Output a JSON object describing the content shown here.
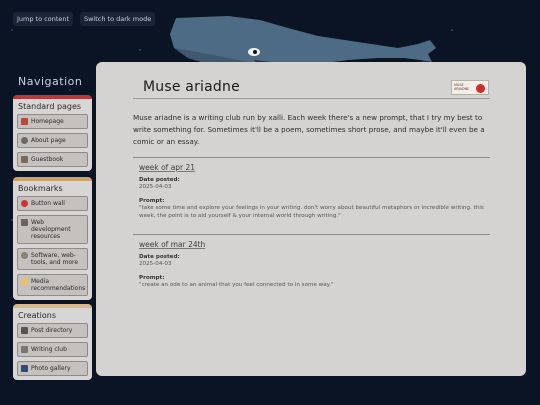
{
  "topbar": {
    "skip_label": "Jump to content",
    "dark_label": "Switch to dark mode"
  },
  "sidebar": {
    "title": "Navigation",
    "sections": [
      {
        "heading": "Standard pages",
        "items": [
          {
            "label": "Homepage",
            "icon": "home-icon"
          },
          {
            "label": "About page",
            "icon": "info-icon"
          },
          {
            "label": "Guestbook",
            "icon": "book-icon"
          }
        ]
      },
      {
        "heading": "Bookmarks",
        "items": [
          {
            "label": "Button wall",
            "icon": "heart-icon"
          },
          {
            "label": "Web development resources",
            "icon": "tools-icon"
          },
          {
            "label": "Software, web-tools, and more",
            "icon": "gear-icon"
          },
          {
            "label": "Media recommendations",
            "icon": "folder-icon"
          }
        ]
      },
      {
        "heading": "Creations",
        "items": [
          {
            "label": "Post directory",
            "icon": "list-icon"
          },
          {
            "label": "Writing club",
            "icon": "pencil-icon"
          },
          {
            "label": "Photo gallery",
            "icon": "camera-icon"
          }
        ]
      }
    ]
  },
  "main": {
    "title": "Muse ariadne",
    "badge_text": "MUSE ARIADNE",
    "intro": "Muse ariadne is a writing club run by xalli. Each week there's a new prompt, that I try my best to write something for. Sometimes it'll be a poem, sometimes short prose, and maybe it'll even be a comic or an essay.",
    "posts": [
      {
        "title": "week of apr 21",
        "date_label": "Date posted:",
        "date": "2025-04-03",
        "prompt_label": "Prompt:",
        "prompt": "\"take some time and explore your feelings in your writing. don't worry about beautiful metaphors or incredible writing. this week, the point is to aid yourself & your internal world through writing.\""
      },
      {
        "title": "week of mar 24th",
        "date_label": "Date posted:",
        "date": "2025-04-03",
        "prompt_label": "Prompt:",
        "prompt": "\"create an ode to an animal that you feel connected to in some way.\""
      }
    ]
  },
  "colors": {
    "background": "#0b1424",
    "panel": "#d5d3d1",
    "accent_red": "#b63a3a",
    "whale": "#4e6b86"
  }
}
